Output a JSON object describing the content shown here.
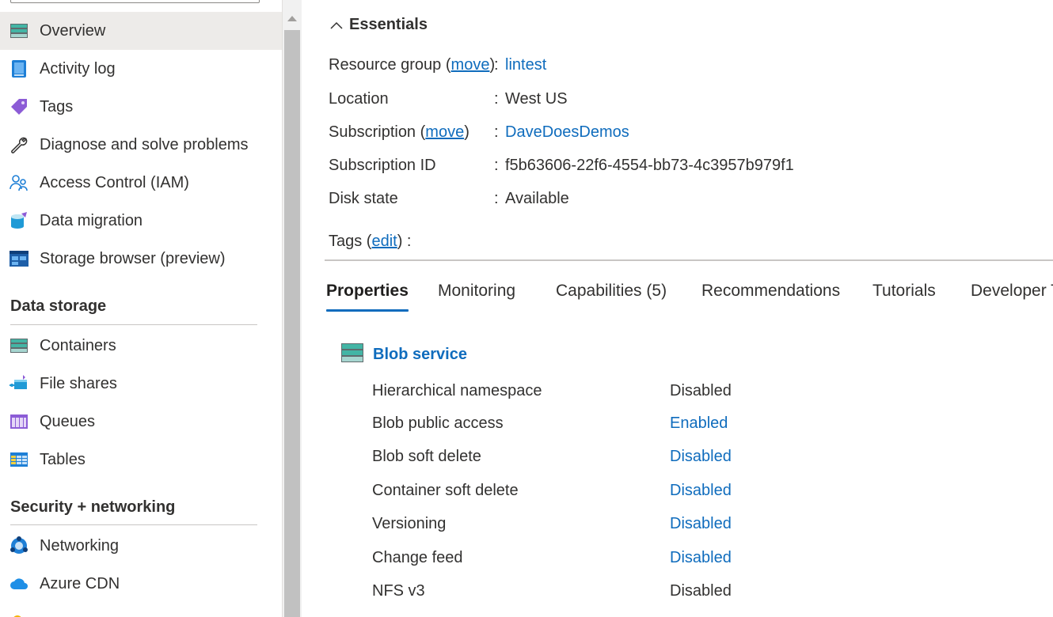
{
  "sidebar": {
    "items": [
      {
        "label": "Overview",
        "icon": "storage-overview-icon"
      },
      {
        "label": "Activity log",
        "icon": "activity-log-icon"
      },
      {
        "label": "Tags",
        "icon": "tag-icon"
      },
      {
        "label": "Diagnose and solve problems",
        "icon": "wrench-icon"
      },
      {
        "label": "Access Control (IAM)",
        "icon": "people-icon"
      },
      {
        "label": "Data migration",
        "icon": "data-migration-icon"
      },
      {
        "label": "Storage browser (preview)",
        "icon": "storage-browser-icon"
      }
    ],
    "sections": [
      {
        "title": "Data storage",
        "items": [
          {
            "label": "Containers",
            "icon": "containers-icon"
          },
          {
            "label": "File shares",
            "icon": "file-shares-icon"
          },
          {
            "label": "Queues",
            "icon": "queues-icon"
          },
          {
            "label": "Tables",
            "icon": "tables-icon"
          }
        ]
      },
      {
        "title": "Security + networking",
        "items": [
          {
            "label": "Networking",
            "icon": "networking-icon"
          },
          {
            "label": "Azure CDN",
            "icon": "cloud-icon"
          }
        ]
      }
    ]
  },
  "essentials": {
    "title": "Essentials",
    "rows": [
      {
        "label": "Resource group",
        "action": "move",
        "value": "lintest",
        "value_is_link": true
      },
      {
        "label": "Location",
        "value": "West US"
      },
      {
        "label": "Subscription",
        "action": "move",
        "value": "DaveDoesDemos",
        "value_is_link": true
      },
      {
        "label": "Subscription ID",
        "value": "f5b63606-22f6-4554-bb73-4c3957b979f1"
      },
      {
        "label": "Disk state",
        "value": "Available"
      }
    ],
    "tags_label": "Tags",
    "tags_action": "edit"
  },
  "tabs": [
    {
      "label": "Properties",
      "active": true
    },
    {
      "label": "Monitoring"
    },
    {
      "label": "Capabilities (5)"
    },
    {
      "label": "Recommendations"
    },
    {
      "label": "Tutorials"
    },
    {
      "label": "Developer T"
    }
  ],
  "blob_service": {
    "title": "Blob service",
    "rows": [
      {
        "label": "Hierarchical namespace",
        "value": "Disabled",
        "value_is_link": false
      },
      {
        "label": "Blob public access",
        "value": "Enabled",
        "value_is_link": true
      },
      {
        "label": "Blob soft delete",
        "value": "Disabled",
        "value_is_link": true
      },
      {
        "label": "Container soft delete",
        "value": "Disabled",
        "value_is_link": true
      },
      {
        "label": "Versioning",
        "value": "Disabled",
        "value_is_link": true
      },
      {
        "label": "Change feed",
        "value": "Disabled",
        "value_is_link": true
      },
      {
        "label": "NFS v3",
        "value": "Disabled",
        "value_is_link": false
      }
    ]
  },
  "colors": {
    "link": "#0f6cbd",
    "selected_bg": "#edebe9",
    "text": "#323130"
  }
}
